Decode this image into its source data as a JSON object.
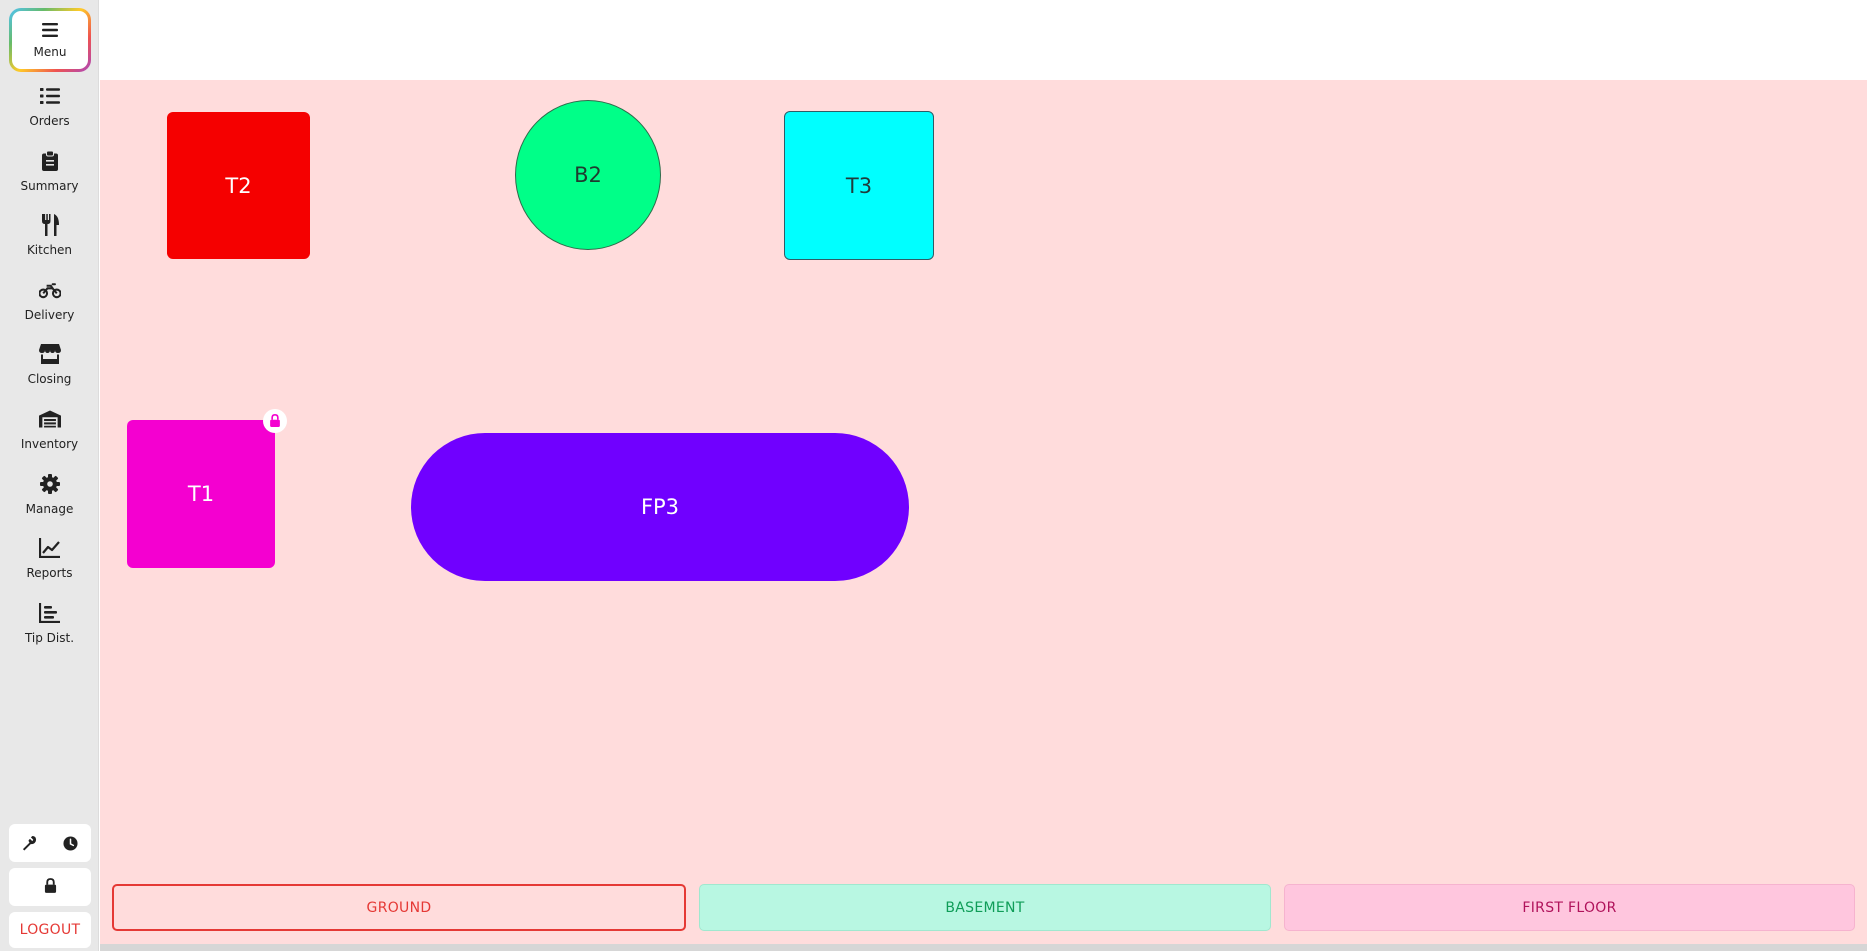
{
  "sidebar": {
    "menu": {
      "label": "Menu",
      "icon": "hamburger-icon"
    },
    "items": [
      {
        "label": "Orders",
        "icon": "list-icon"
      },
      {
        "label": "Summary",
        "icon": "clipboard-icon"
      },
      {
        "label": "Kitchen",
        "icon": "utensils-icon"
      },
      {
        "label": "Delivery",
        "icon": "motorcycle-icon"
      },
      {
        "label": "Closing",
        "icon": "store-icon"
      },
      {
        "label": "Inventory",
        "icon": "warehouse-icon"
      },
      {
        "label": "Manage",
        "icon": "gear-icon"
      },
      {
        "label": "Reports",
        "icon": "line-chart-icon"
      },
      {
        "label": "Tip Dist.",
        "icon": "bar-chart-icon"
      }
    ],
    "tools": [
      "wrench-icon",
      "clock-icon"
    ],
    "lock_icon": "lock-icon",
    "logout_label": "LOGOUT"
  },
  "floor": {
    "background": "#ffdcdc",
    "tables": [
      {
        "label": "T2",
        "shape": "square",
        "color": "#f50000"
      },
      {
        "label": "B2",
        "shape": "circle",
        "color": "#00ff88"
      },
      {
        "label": "T3",
        "shape": "square",
        "color": "#00ffff"
      },
      {
        "label": "T1",
        "shape": "square",
        "color": "#f400d0",
        "locked": true
      },
      {
        "label": "FP3",
        "shape": "pill",
        "color": "#7000ff"
      }
    ]
  },
  "floor_tabs": [
    {
      "label": "GROUND",
      "active": true,
      "color": "#e53935"
    },
    {
      "label": "BASEMENT",
      "active": false,
      "color": "#0f9d58"
    },
    {
      "label": "FIRST FLOOR",
      "active": false,
      "color": "#b0135b"
    }
  ]
}
